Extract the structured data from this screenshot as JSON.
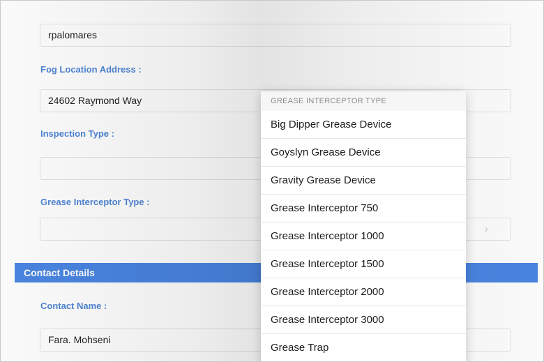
{
  "form": {
    "inspector_value": "rpalomares",
    "fog_location_label": "Fog Location Address :",
    "fog_location_value": "24602 Raymond Way",
    "inspection_type_label": "Inspection Type :",
    "inspection_type_value": "",
    "grease_interceptor_label": "Grease Interceptor Type :",
    "grease_interceptor_value": "",
    "select_chevron": "›"
  },
  "contact": {
    "section_title": "Contact Details",
    "contact_name_label": "Contact Name :",
    "contact_name_value": "Fara. Mohseni"
  },
  "popover": {
    "header": "GREASE INTERCEPTOR TYPE",
    "options": [
      "Big Dipper Grease Device",
      "Goyslyn Grease Device",
      "Gravity Grease Device",
      "Grease Interceptor 750",
      "Grease Interceptor 1000",
      "Grease Interceptor 1500",
      "Grease Interceptor 2000",
      "Grease Interceptor 3000",
      "Grease Trap"
    ]
  },
  "colors": {
    "accent": "#4a86e3",
    "label": "#4f86d6"
  }
}
